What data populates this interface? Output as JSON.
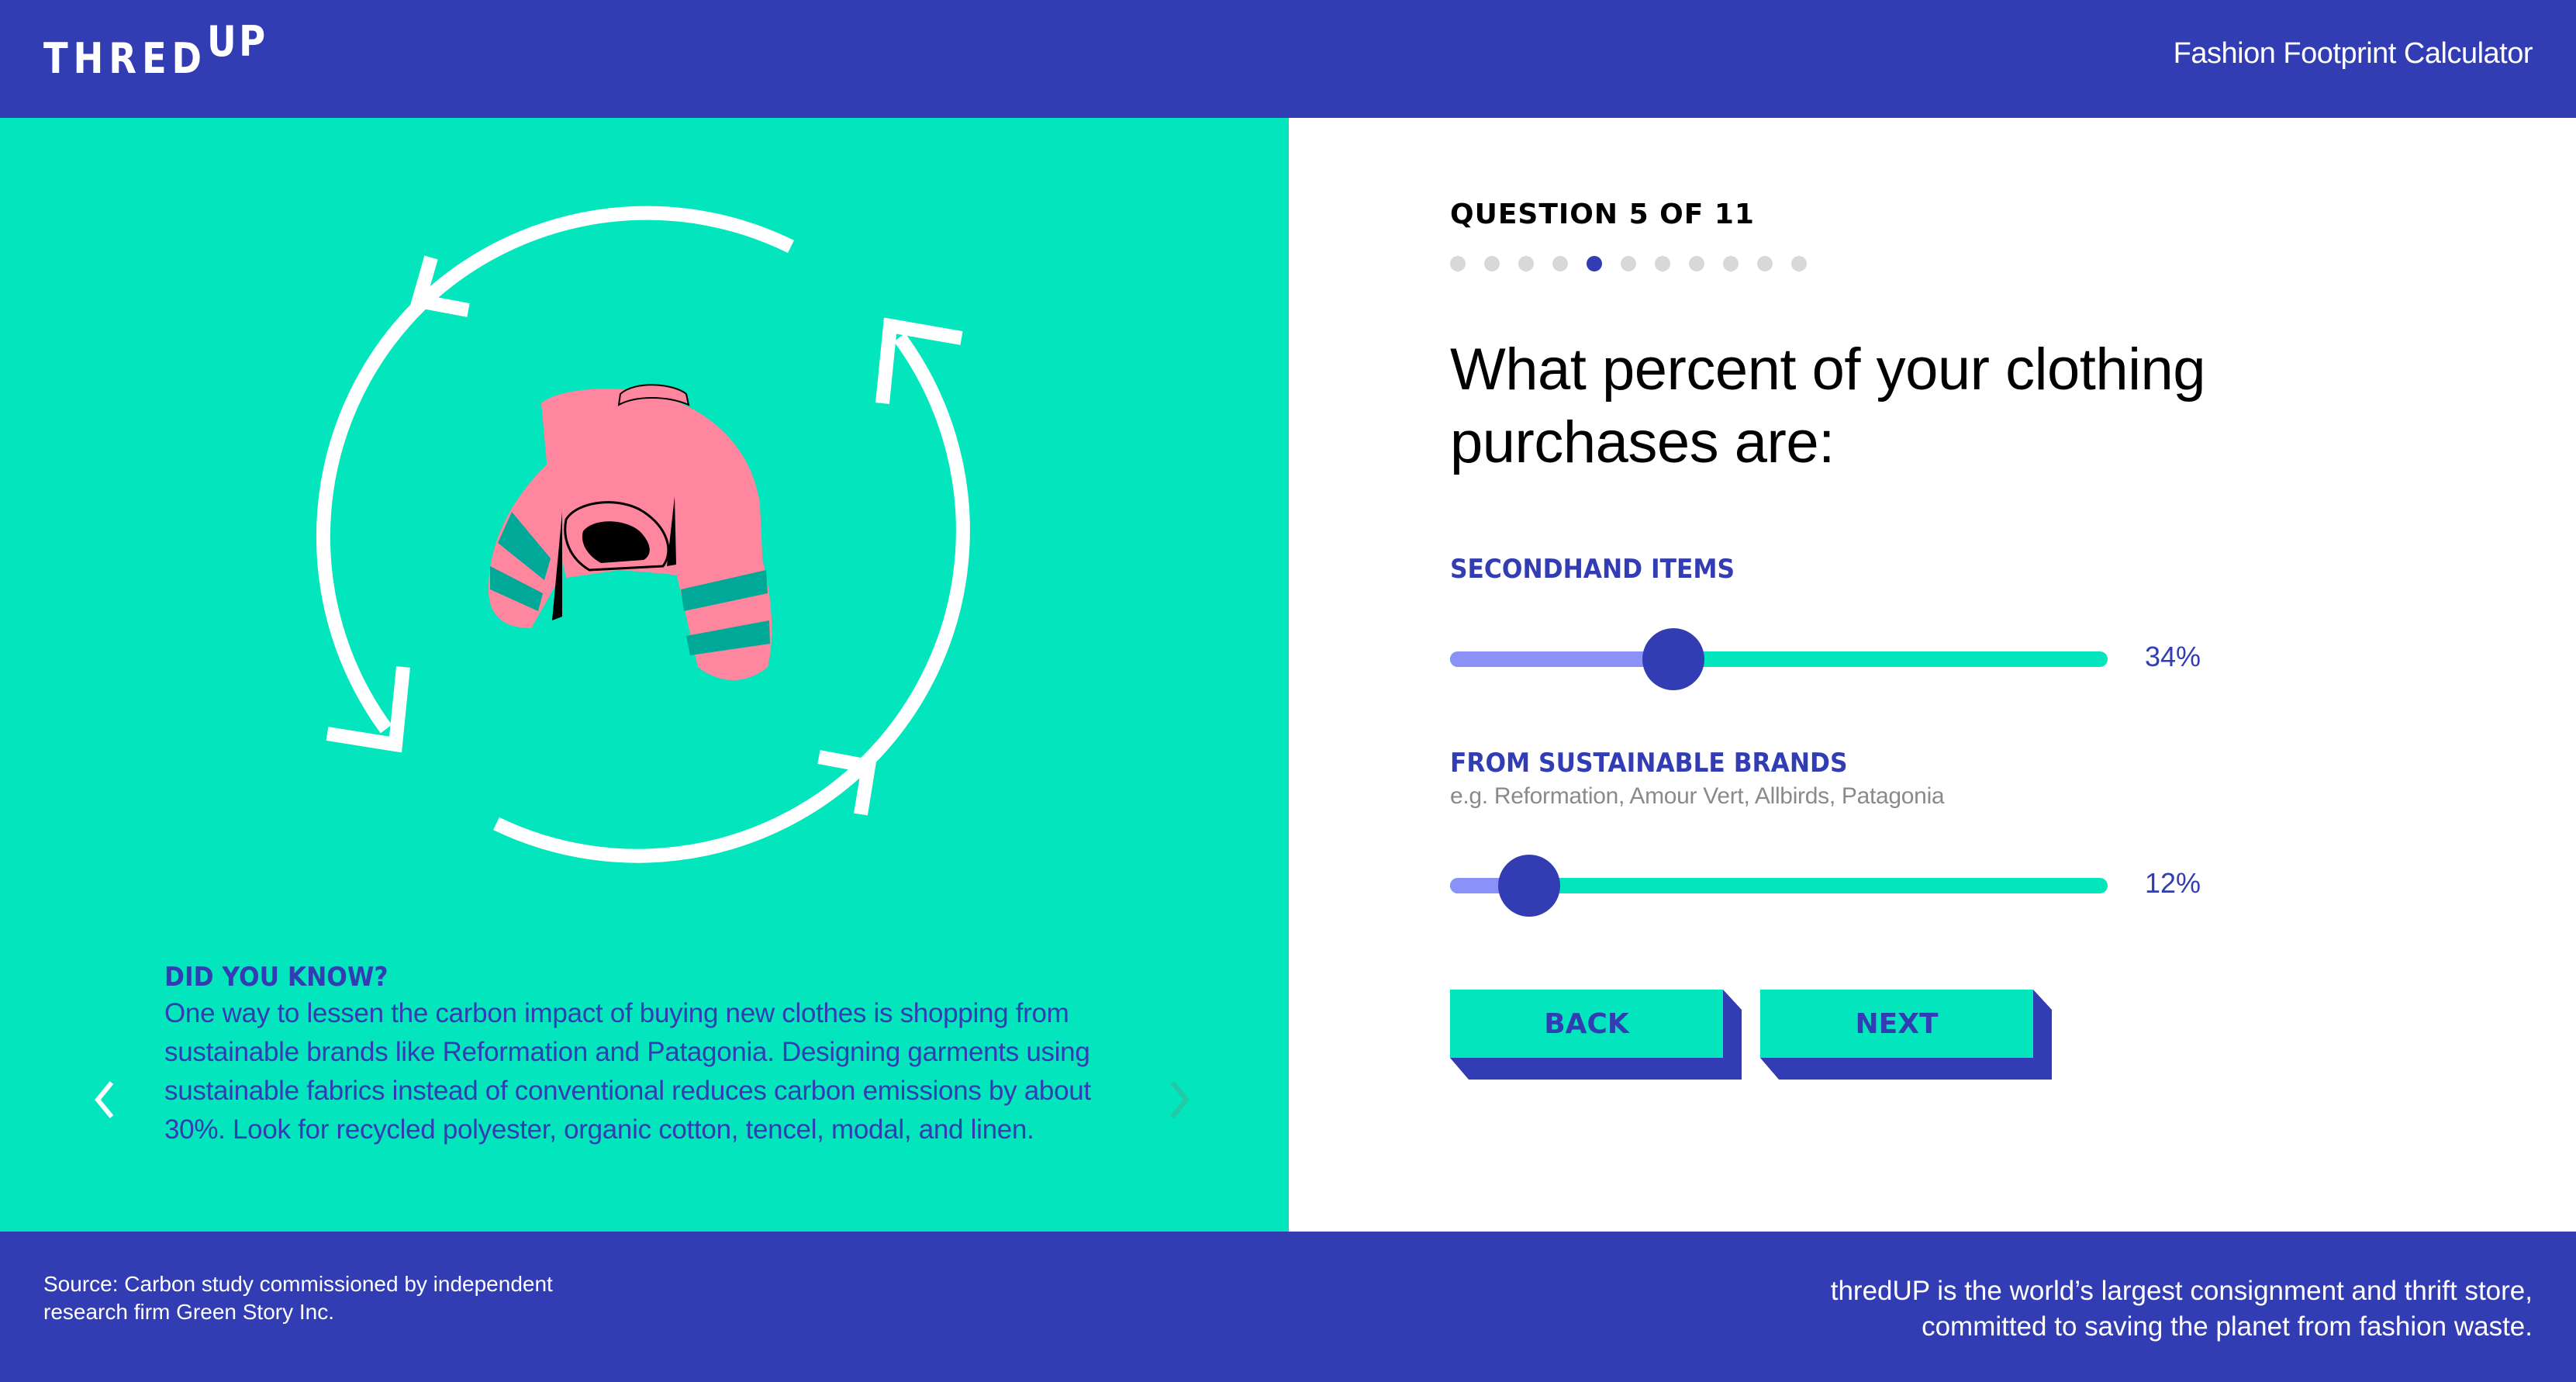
{
  "header": {
    "logo_main": "THRED",
    "logo_sup": "UP",
    "app_title": "Fashion Footprint Calculator"
  },
  "illustration": {
    "recycle_icon": "recycle-arrows-icon",
    "garment_icon": "sweater-icon"
  },
  "did_you_know": {
    "title": "DID YOU KNOW?",
    "body": "One way to lessen the carbon impact of buying new clothes is shopping from sustainable brands like Reformation and Patagonia. Designing garments using sustainable fabrics instead of conventional reduces carbon emissions by about 30%. Look for recycled polyester, organic cotton, tencel, modal, and linen.",
    "prev_icon": "chevron-left-icon",
    "next_icon": "chevron-right-icon"
  },
  "question": {
    "label": "QUESTION 5 OF 11",
    "current": 5,
    "total": 11,
    "text": "What percent of your clothing purchases are:"
  },
  "sliders": [
    {
      "label": "SECONDHAND ITEMS",
      "subtitle": "",
      "value": 34,
      "value_label": "34%"
    },
    {
      "label": "FROM SUSTAINABLE BRANDS",
      "subtitle": "e.g. Reformation, Amour Vert, Allbirds, Patagonia",
      "value": 12,
      "value_label": "12%"
    }
  ],
  "buttons": {
    "back": "BACK",
    "next": "NEXT"
  },
  "footer": {
    "source": "Source: Carbon study commissioned by independent research firm Green Story Inc.",
    "tagline_line1": "thredUP is the world’s largest consignment and thrift store,",
    "tagline_line2": "committed to saving the planet from fashion waste."
  },
  "colors": {
    "brand_blue": "#333DB3",
    "teal": "#02E5BD",
    "slider_fill": "#8A92F7",
    "dot_inactive": "#D8D8D8",
    "sweater_pink": "#FF869F",
    "stripe_teal": "#00A898"
  }
}
